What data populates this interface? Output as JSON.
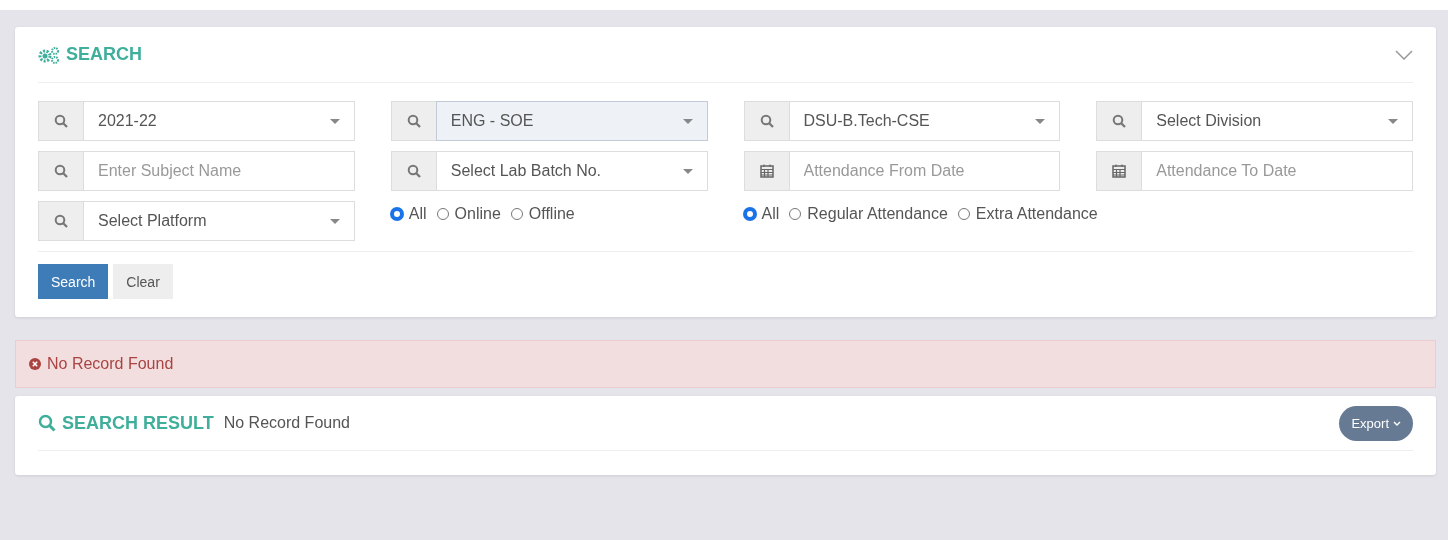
{
  "search_panel": {
    "title": "SEARCH",
    "fields": [
      {
        "kind": "select",
        "value": "2021-22",
        "focused": false
      },
      {
        "kind": "select",
        "value": "ENG - SOE",
        "focused": true
      },
      {
        "kind": "select",
        "value": "DSU-B.Tech-CSE",
        "focused": false
      },
      {
        "kind": "select",
        "value": "Select Division",
        "focused": false
      },
      {
        "kind": "text",
        "placeholder": "Enter Subject Name",
        "focused": false
      },
      {
        "kind": "select",
        "value": "Select Lab Batch No.",
        "focused": false
      },
      {
        "kind": "date",
        "placeholder": "Attendance From Date",
        "focused": false
      },
      {
        "kind": "date",
        "placeholder": "Attendance To Date",
        "focused": false
      },
      {
        "kind": "select",
        "value": "Select Platform",
        "focused": false
      }
    ],
    "radio_groups": [
      {
        "options": [
          {
            "label": "All",
            "selected": true
          },
          {
            "label": "Online",
            "selected": false
          },
          {
            "label": "Offline",
            "selected": false
          }
        ]
      },
      {
        "options": [
          {
            "label": "All",
            "selected": true
          },
          {
            "label": "Regular Attendance",
            "selected": false
          },
          {
            "label": "Extra Attendance",
            "selected": false
          }
        ]
      }
    ],
    "buttons": [
      {
        "label": "Search",
        "kind": "primary"
      },
      {
        "label": "Clear",
        "kind": "default"
      }
    ]
  },
  "alert": {
    "message": "No Record Found"
  },
  "result_panel": {
    "title": "SEARCH RESULT",
    "status": "No Record Found",
    "export_button": "Export"
  }
}
